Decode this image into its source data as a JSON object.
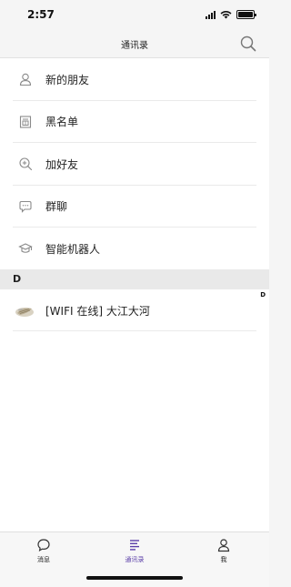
{
  "status_bar": {
    "time": "2:57"
  },
  "nav": {
    "title": "通讯录"
  },
  "menu": [
    {
      "label": "新的朋友",
      "icon": "person-icon"
    },
    {
      "label": "黑名单",
      "icon": "blacklist-icon"
    },
    {
      "label": "加好友",
      "icon": "add-friend-search-icon"
    },
    {
      "label": "群聊",
      "icon": "group-chat-icon"
    },
    {
      "label": "智能机器人",
      "icon": "robot-icon"
    }
  ],
  "section": {
    "letter": "D"
  },
  "index": {
    "letter": "D"
  },
  "contacts": [
    {
      "name": "[WIFI 在线] 大江大河",
      "avatar": "avatar"
    }
  ],
  "tabs": [
    {
      "label": "消息",
      "icon": "message-icon"
    },
    {
      "label": "通讯录",
      "icon": "contacts-icon",
      "active": true
    },
    {
      "label": "我",
      "icon": "profile-icon"
    }
  ],
  "colors": {
    "accent": "#5b3fa8",
    "icon_gray": "#8a8a8a"
  }
}
